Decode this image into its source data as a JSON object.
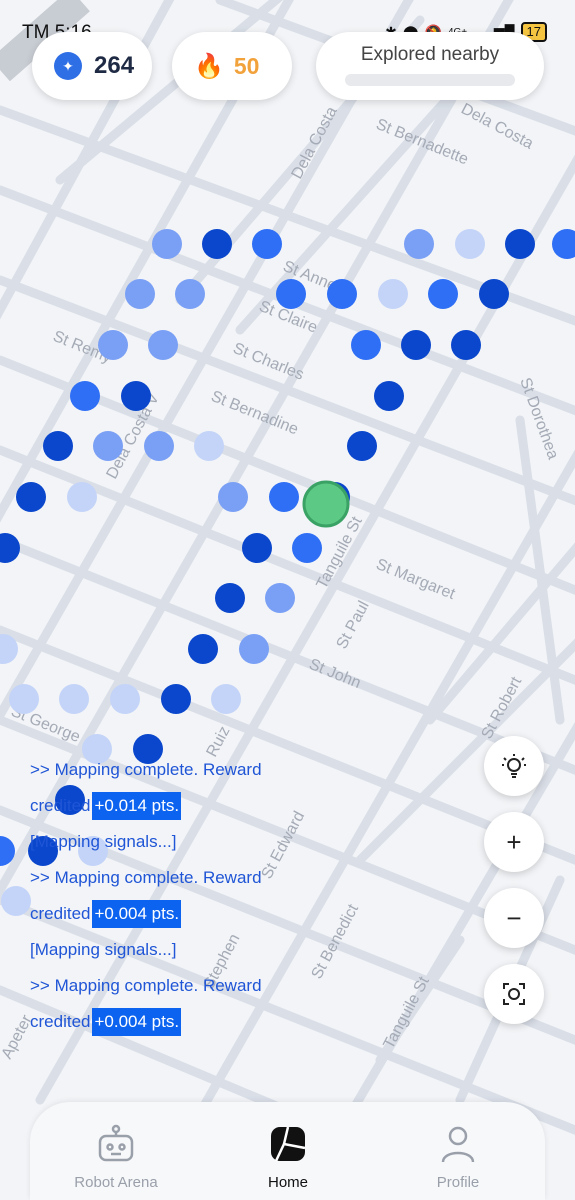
{
  "status_bar": {
    "time": "TM 5:16",
    "signal": "4G+",
    "battery": "17"
  },
  "stats": {
    "coins": "264",
    "streak": "50",
    "explored_label": "Explored nearby"
  },
  "map": {
    "streets": [
      "St Bernadette",
      "Dela Costa",
      "St Anne",
      "St Claire",
      "St Charles",
      "St Remy",
      "Dela Costa V",
      "St Bernadine",
      "St Dorothea",
      "Tanguile St",
      "St Margaret",
      "St Paul",
      "St John",
      "St Robert",
      "St George",
      "Ruiz",
      "St Edward",
      "St Benedict",
      "Tanguile St",
      "Apeter",
      "Stephen"
    ],
    "colors": {
      "dark": "#0a47cc",
      "mid": "#2f6ff5",
      "light": "#7aa0f5",
      "pale": "#c4d4f8",
      "user": "#5cc985"
    }
  },
  "log": {
    "lines": [
      {
        "text": ">> Mapping complete. Reward",
        "reward": ""
      },
      {
        "text": "credited",
        "reward": "+0.014 pts."
      },
      {
        "text": "[Mapping signals...]",
        "reward": ""
      },
      {
        "text": ">> Mapping complete. Reward",
        "reward": ""
      },
      {
        "text": "credited",
        "reward": "+0.004 pts."
      },
      {
        "text": "[Mapping signals...]",
        "reward": ""
      },
      {
        "text": ">> Mapping complete. Reward",
        "reward": ""
      },
      {
        "text": "credited",
        "reward": "+0.004 pts."
      }
    ]
  },
  "controls": {
    "hint_icon": "lightbulb-icon",
    "zoom_in": "+",
    "zoom_out": "−",
    "locate_icon": "locate-icon"
  },
  "nav": {
    "robot_arena": "Robot Arena",
    "home": "Home",
    "profile": "Profile"
  }
}
